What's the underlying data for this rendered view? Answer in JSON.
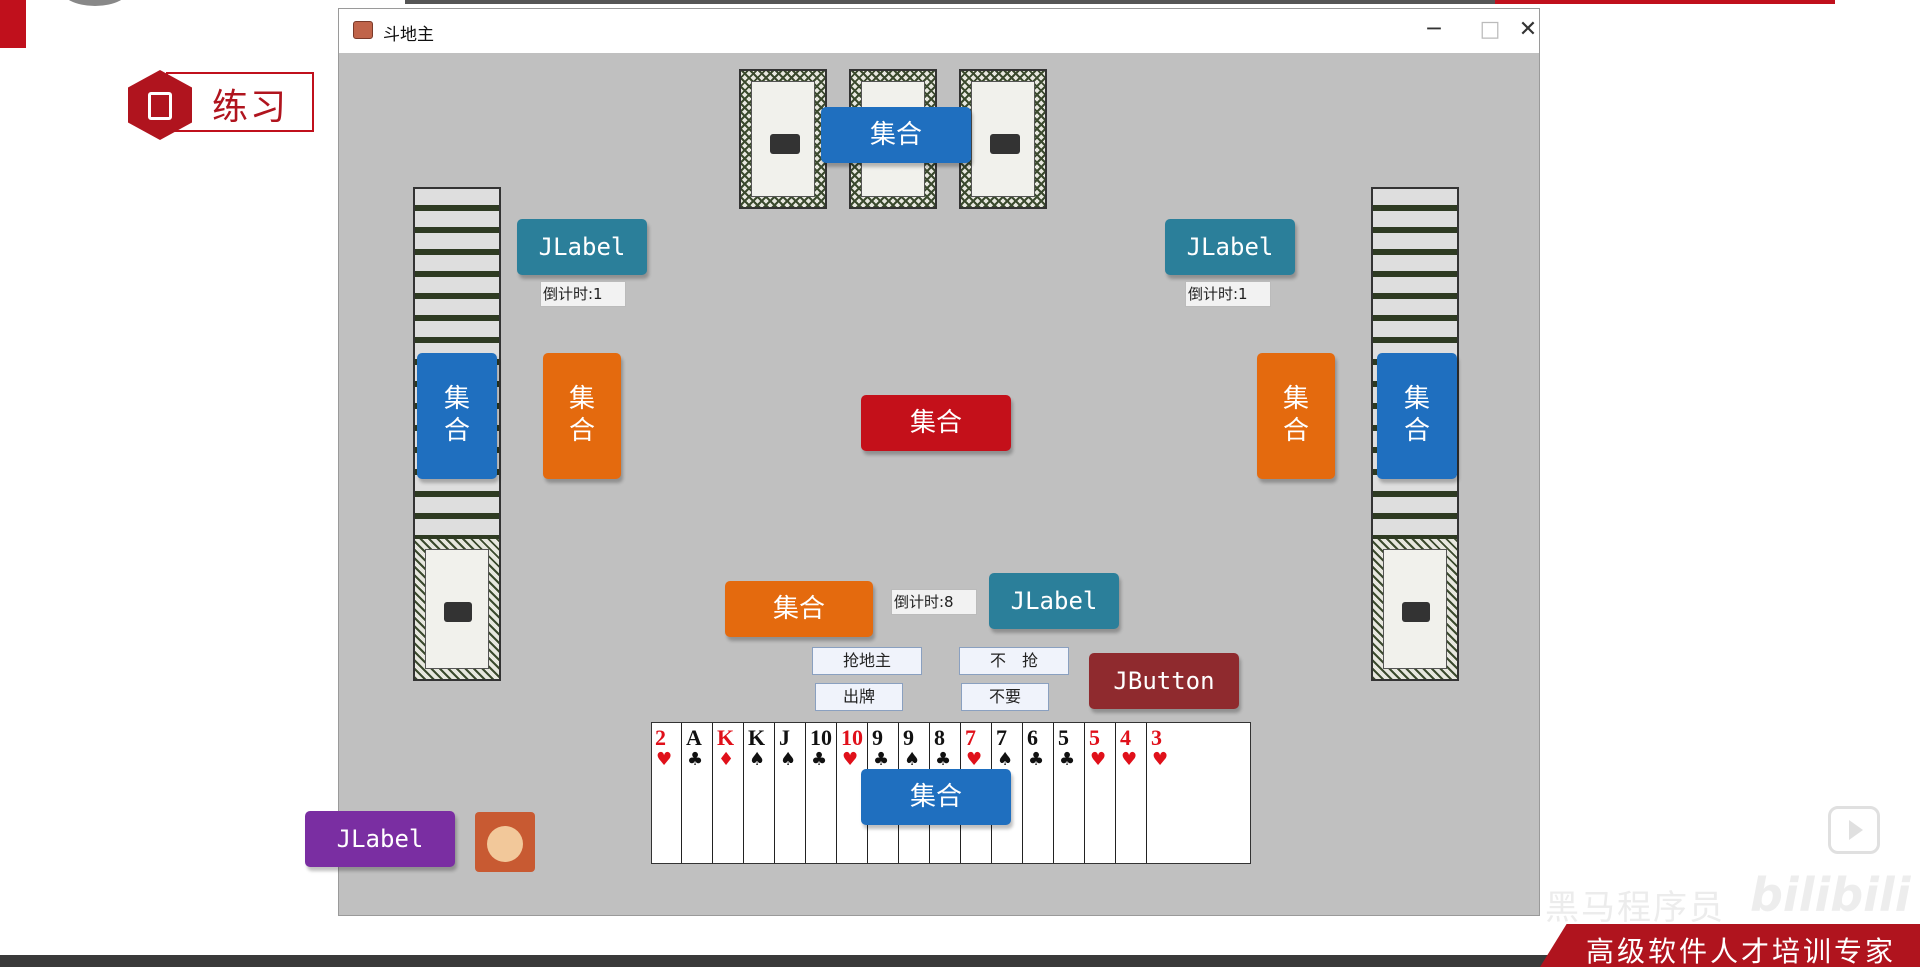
{
  "slide": {
    "practice_label": "练习",
    "footer_tagline": "高级软件人才培训专家",
    "watermark_text": "黑马程序员",
    "watermark_logo": "bilibili"
  },
  "window": {
    "title": "斗地主",
    "minimize": "─",
    "maximize": "□",
    "close": "✕"
  },
  "game": {
    "top_collection": "集合",
    "left_collection": "集\n合",
    "left_orange": "集\n合",
    "right_orange": "集\n合",
    "right_collection": "集\n合",
    "center_collection": "集合",
    "bottom_orange": "集合",
    "hand_collection": "集合",
    "left_jlabel": "JLabel",
    "right_jlabel": "JLabel",
    "bottom_jlabel": "JLabel",
    "player_jlabel": "JLabel",
    "jbutton": "JButton",
    "left_countdown": "倒计时:1",
    "right_countdown": "倒计时:1",
    "bottom_countdown": "倒计时:8",
    "grab_landlord": "抢地主",
    "no_grab": "不　抢",
    "play_cards": "出牌",
    "pass": "不要"
  },
  "colors": {
    "blue": "#1f6fbf",
    "orange": "#e46a0e",
    "red": "#c4101a",
    "teal": "#2b7f9a",
    "maroon": "#8f2a2e",
    "purple": "#7a2ea2"
  },
  "hand_cards": [
    {
      "rank": "2",
      "suit": "♥",
      "color": "#e0101a"
    },
    {
      "rank": "A",
      "suit": "♣",
      "color": "#111"
    },
    {
      "rank": "K",
      "suit": "♦",
      "color": "#e0101a"
    },
    {
      "rank": "K",
      "suit": "♠",
      "color": "#111"
    },
    {
      "rank": "J",
      "suit": "♠",
      "color": "#111"
    },
    {
      "rank": "10",
      "suit": "♣",
      "color": "#111"
    },
    {
      "rank": "10",
      "suit": "♥",
      "color": "#e0101a"
    },
    {
      "rank": "9",
      "suit": "♣",
      "color": "#111"
    },
    {
      "rank": "9",
      "suit": "♠",
      "color": "#111"
    },
    {
      "rank": "8",
      "suit": "♣",
      "color": "#111"
    },
    {
      "rank": "7",
      "suit": "♥",
      "color": "#e0101a"
    },
    {
      "rank": "7",
      "suit": "♠",
      "color": "#111"
    },
    {
      "rank": "6",
      "suit": "♣",
      "color": "#111"
    },
    {
      "rank": "5",
      "suit": "♣",
      "color": "#111"
    },
    {
      "rank": "5",
      "suit": "♥",
      "color": "#e0101a"
    },
    {
      "rank": "4",
      "suit": "♥",
      "color": "#e0101a"
    },
    {
      "rank": "3",
      "suit": "♥",
      "color": "#e0101a"
    }
  ]
}
